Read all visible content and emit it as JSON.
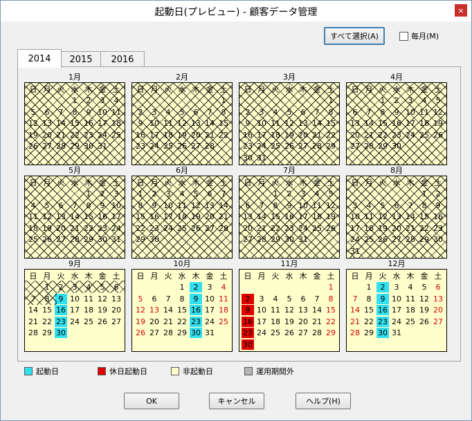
{
  "window": {
    "title": "起動日(プレビュー) - 顧客データ管理",
    "close_label": "×"
  },
  "toolbar": {
    "select_all_label": "すべて選択(A)",
    "monthly_label": "毎月(M)"
  },
  "tabs": [
    "2014",
    "2015",
    "2016"
  ],
  "weekday_headers": [
    "日",
    "月",
    "火",
    "水",
    "木",
    "金",
    "土"
  ],
  "months": [
    {
      "label": "1月",
      "start": 3,
      "days": 31,
      "hatched": true
    },
    {
      "label": "2月",
      "start": 6,
      "days": 28,
      "hatched": true
    },
    {
      "label": "3月",
      "start": 6,
      "days": 31,
      "hatched": true
    },
    {
      "label": "4月",
      "start": 2,
      "days": 30,
      "hatched": true
    },
    {
      "label": "5月",
      "start": 4,
      "days": 31,
      "hatched": true
    },
    {
      "label": "6月",
      "start": 0,
      "days": 30,
      "hatched": true
    },
    {
      "label": "7月",
      "start": 2,
      "days": 31,
      "hatched": true
    },
    {
      "label": "8月",
      "start": 5,
      "days": 31,
      "hatched": true
    },
    {
      "label": "9月",
      "start": 1,
      "days": 30,
      "hatched_through": 8,
      "startup_days": [
        9,
        16,
        23,
        30
      ],
      "holiday_days": []
    },
    {
      "label": "10月",
      "start": 3,
      "days": 31,
      "startup_days": [
        2,
        9,
        16,
        23,
        30
      ],
      "holiday_days": [],
      "red_days": [
        4,
        5,
        11,
        12,
        13,
        18,
        19,
        25,
        26
      ]
    },
    {
      "label": "11月",
      "start": 6,
      "days": 30,
      "startup_days": [],
      "holiday_days": [
        2,
        9,
        16,
        23,
        30
      ],
      "red_days": [
        1,
        8,
        15,
        22,
        29
      ]
    },
    {
      "label": "12月",
      "start": 1,
      "days": 31,
      "startup_days": [
        2,
        9,
        16,
        23,
        30
      ],
      "holiday_days": [],
      "red_days": [
        6,
        7,
        13,
        14,
        20,
        21,
        27,
        28
      ]
    }
  ],
  "legend": [
    {
      "label": "起動日",
      "color": "#33e0f0"
    },
    {
      "label": "休日起動日",
      "color": "#e00000"
    },
    {
      "label": "非起動日",
      "color": "#ffffcc"
    },
    {
      "label": "運用期間外",
      "color": "#b4b4b4"
    }
  ],
  "buttons": {
    "ok": "OK",
    "cancel": "キャンセル",
    "help": "ヘルプ(H)"
  }
}
